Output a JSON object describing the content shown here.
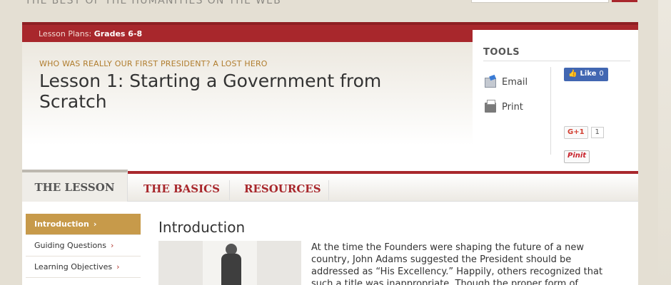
{
  "site": {
    "tagline": "THE BEST OF THE HUMANITIES ON THE WEB"
  },
  "breadcrumb": {
    "prefix": "Lesson Plans:",
    "grades": "Grades 6-8"
  },
  "lesson": {
    "kicker": "WHO WAS REALLY OUR FIRST PRESIDENT? A LOST HERO",
    "title": "Lesson 1: Starting a Government from Scratch"
  },
  "tools": {
    "title": "TOOLS",
    "email_label": "Email",
    "print_label": "Print",
    "fb_like_label": "Like",
    "fb_like_count": "0",
    "gplus_label": "G+1",
    "gplus_count": "1",
    "pinit_label": "Pinit"
  },
  "tabs": [
    {
      "label": "THE LESSON",
      "active": true
    },
    {
      "label": "THE BASICS",
      "active": false
    },
    {
      "label": "RESOURCES",
      "active": false
    }
  ],
  "sidebar": {
    "items": [
      {
        "label": "Introduction",
        "active": true
      },
      {
        "label": "Guiding Questions",
        "active": false
      },
      {
        "label": "Learning Objectives",
        "active": false
      }
    ],
    "arrow": "›"
  },
  "content": {
    "heading": "Introduction",
    "paragraph": "At the time the Founders were shaping the future of a new country, John Adams suggested the President should be addressed as “His Excellency.” Happily, others recognized that such a title was inappropriate. Though the proper form of"
  },
  "colors": {
    "accent_red": "#a8272c",
    "active_sidebar": "#c79a4a",
    "kicker_gold": "#b07d2e",
    "facebook_blue": "#4267b2"
  }
}
